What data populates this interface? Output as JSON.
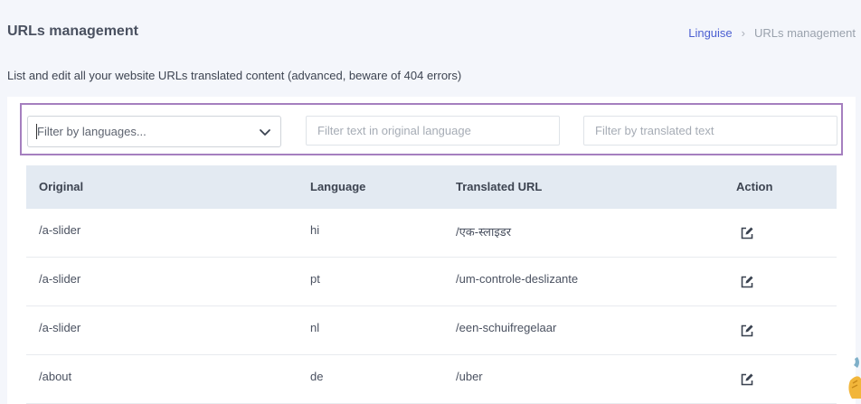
{
  "header": {
    "title": "URLs management",
    "breadcrumb": {
      "root": "Linguise",
      "separator": "›",
      "current": "URLs management"
    }
  },
  "description": "List and edit all your website URLs translated content (advanced, beware of 404 errors)",
  "filters": {
    "language_select_value": "Filter by languages...",
    "original_placeholder": "Filter text in original language",
    "translated_placeholder": "Filter by translated text"
  },
  "table": {
    "columns": [
      "Original",
      "Language",
      "Translated URL",
      "Action"
    ],
    "rows": [
      {
        "original": "/a-slider",
        "language": "hi",
        "translated": "/एक-स्लाइडर"
      },
      {
        "original": "/a-slider",
        "language": "pt",
        "translated": "/um-controle-deslizante"
      },
      {
        "original": "/a-slider",
        "language": "nl",
        "translated": "/een-schuifregelaar"
      },
      {
        "original": "/about",
        "language": "de",
        "translated": "/uber"
      }
    ]
  },
  "colors": {
    "accent": "#4b5fd1",
    "filter_border": "#a57fbf",
    "table_header_bg": "#e3eaf2",
    "page_bg": "#f4f6fb"
  },
  "icons": {
    "edit": "edit-icon",
    "dropdown": "chevron-down-icon"
  }
}
